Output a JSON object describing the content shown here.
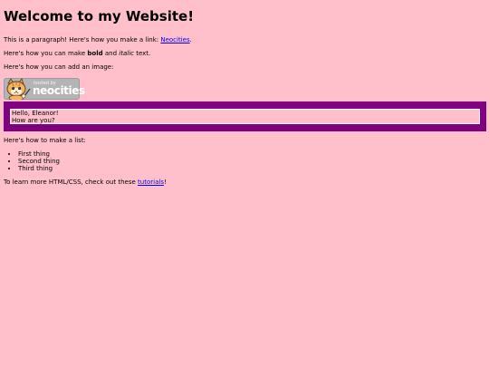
{
  "heading": "Welcome to my Website!",
  "link_paragraph": {
    "before": "This is a paragraph! Here's how you make a link: ",
    "link_text": "Neocities",
    "after": "."
  },
  "format_paragraph": {
    "before": "Here's how you can make ",
    "bold": "bold",
    "middle": " and ",
    "italic": "italic",
    "after": " text."
  },
  "image_paragraph": "Here's how you can add an image:",
  "badge": {
    "line1": "hosted by",
    "line2": "neocities",
    "icon": "neocities-cat-icon"
  },
  "box": {
    "line1": "Hello, Eleanor!",
    "line2": "How are you?"
  },
  "list_intro": "Here's how to make a list:",
  "list_items": [
    "First thing",
    "Second thing",
    "Third thing"
  ],
  "learn_paragraph": {
    "before": "To learn more HTML/CSS, check out these ",
    "link_text": "tutorials",
    "after": "!"
  },
  "colors": {
    "background": "#ffc0cb",
    "box": "#800080",
    "link": "#0000ee"
  }
}
